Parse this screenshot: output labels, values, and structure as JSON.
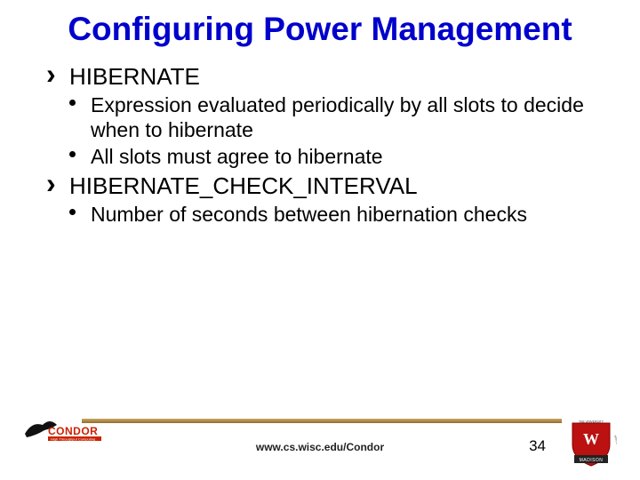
{
  "title": "Configuring Power Management",
  "items": [
    {
      "label": "HIBERNATE",
      "sub": [
        "Expression evaluated periodically by all slots to decide when to hibernate",
        "All slots must agree to hibernate"
      ]
    },
    {
      "label": "HIBERNATE_CHECK_INTERVAL",
      "sub": [
        "Number of seconds between hibernation checks"
      ]
    }
  ],
  "footer": {
    "url": "www.cs.wisc.edu/Condor",
    "page": "34",
    "logo_left_name": "condor",
    "logo_right_name": "university-of-wisconsin"
  }
}
